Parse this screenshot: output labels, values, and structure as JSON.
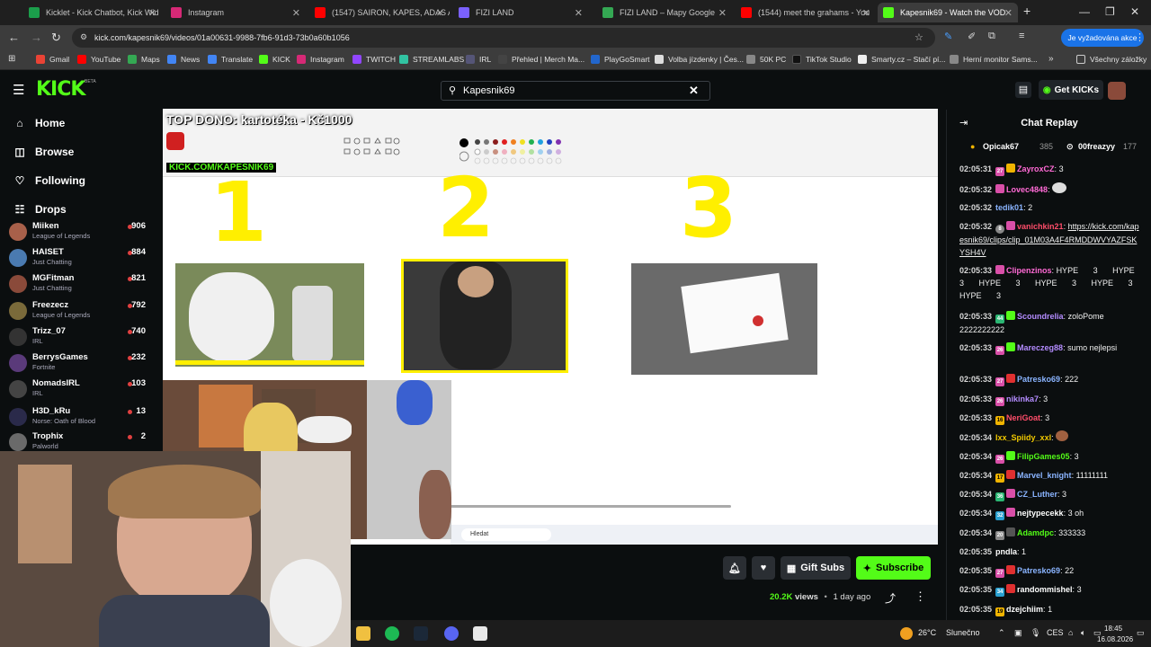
{
  "browser": {
    "tabs": [
      {
        "title": "Kicklet - Kick Chatbot, Kick Wid",
        "color": "#1b9e4b"
      },
      {
        "title": "Instagram",
        "color": "#d62976"
      },
      {
        "title": "(1547) SAIRON, KAPES, ADAS A",
        "color": "#ff0000"
      },
      {
        "title": "FIZI LAND",
        "color": "#7b61ff"
      },
      {
        "title": "FIZI LAND – Mapy Google",
        "color": "#34a853"
      },
      {
        "title": "(1544) meet the grahams - You",
        "color": "#ff0000"
      },
      {
        "title": "Kapesnik69 - Watch the VOD",
        "color": "#53fc18"
      }
    ],
    "url": "kick.com/kapesnik69/videos/01a00631-9988-7fb6-91d3-73b0a60b1056",
    "relaunch_label": "Je vyžadována akce",
    "bookmarks": [
      {
        "label": "Gmail",
        "color": "#ea4335"
      },
      {
        "label": "YouTube",
        "color": "#ff0000"
      },
      {
        "label": "Maps",
        "color": "#34a853"
      },
      {
        "label": "News",
        "color": "#4285f4"
      },
      {
        "label": "Translate",
        "color": "#4285f4"
      },
      {
        "label": "KICK",
        "color": "#53fc18"
      },
      {
        "label": "Instagram",
        "color": "#d62976"
      },
      {
        "label": "TWITCH",
        "color": "#9146ff"
      },
      {
        "label": "STREAMLABS",
        "color": "#31c3a2"
      },
      {
        "label": "IRL",
        "color": "#555577"
      },
      {
        "label": "Přehled | Merch Ma...",
        "color": "#444"
      },
      {
        "label": "PlayGoSmart",
        "color": "#2266cc"
      },
      {
        "label": "Volba jízdenky | Čes...",
        "color": "#dddddd"
      },
      {
        "label": "50K PC",
        "color": "#888"
      },
      {
        "label": "TikTok Studio",
        "color": "#111"
      },
      {
        "label": "Smarty.cz – Stačí pí...",
        "color": "#eeeeee"
      },
      {
        "label": "Herní monitor Sams...",
        "color": "#888"
      }
    ],
    "all_bookmarks": "Všechny záložky"
  },
  "kick": {
    "logo": "KICK",
    "logo_beta": "BETA",
    "search_value": "Kapesnik69",
    "get_kicks": "Get KICKs",
    "nav": [
      "Home",
      "Browse",
      "Following",
      "Drops"
    ],
    "channels": [
      {
        "name": "Miiken",
        "game": "League of Legends",
        "viewers": "906",
        "color": "#a8604a"
      },
      {
        "name": "HAISET",
        "game": "Just Chatting",
        "viewers": "884",
        "color": "#4a7ab0"
      },
      {
        "name": "MGFitman",
        "game": "Just Chatting",
        "viewers": "821",
        "color": "#8a4a3a"
      },
      {
        "name": "Freezecz",
        "game": "League of Legends",
        "viewers": "792",
        "color": "#7a6a3a"
      },
      {
        "name": "Trizz_07",
        "game": "IRL",
        "viewers": "740",
        "color": "#333333"
      },
      {
        "name": "BerrysGames",
        "game": "Fortnite",
        "viewers": "232",
        "color": "#5a3a7a"
      },
      {
        "name": "NomadsIRL",
        "game": "IRL",
        "viewers": "103",
        "color": "#444444"
      },
      {
        "name": "H3D_kRu",
        "game": "Norse: Oath of Blood",
        "viewers": "13",
        "color": "#2a2a4a"
      },
      {
        "name": "Trophix",
        "game": "Palworld",
        "viewers": "2",
        "color": "#6a6a6a"
      }
    ],
    "video": {
      "top_dono": "TOP DONO: kartotéka - Kč1000",
      "kick_url": "KICK.COM/KAPESNIK69",
      "numbers": [
        "1",
        "2",
        "3"
      ],
      "taskbar_search": "Hledat"
    },
    "actions": {
      "gift_subs": "Gift Subs",
      "subscribe": "Subscribe"
    },
    "meta": {
      "views": "20.2K",
      "views_label": "views",
      "separator": "•",
      "age": "1 day ago"
    }
  },
  "chat": {
    "title": "Chat Replay",
    "pinned": [
      {
        "name": "Opicak67",
        "count": "385"
      },
      {
        "name": "00freazyy",
        "count": "177"
      }
    ],
    "messages": [
      {
        "ts": "02:05:31",
        "badge": "27",
        "badge_color": "#d94fa8",
        "user": "ZayroxCZ",
        "color": "#ff6ad5",
        "text": "3"
      },
      {
        "ts": "02:05:32",
        "badge": "",
        "badge_color": "#d94fa8",
        "user": "Lovec4848",
        "color": "#ff6ad5",
        "text": ""
      },
      {
        "ts": "02:05:32",
        "badge": "",
        "badge_color": "",
        "user": "tedik01",
        "color": "#8ab4ff",
        "text": "2"
      },
      {
        "ts": "02:05:32",
        "badge": "8",
        "badge_color": "#888",
        "user": "vanichkin21",
        "color": "#ff4d6a",
        "text": "https://kick.com/kapesnik69/clips/clip_01M03A4F4RMDDWVYAZFSKYSH4V"
      },
      {
        "ts": "02:05:33",
        "badge": "",
        "badge_color": "#d94fa8",
        "user": "Clipenzinos",
        "color": "#ff6ad5",
        "text": "HYPE 3 HYPE 3 HYPE 3 HYPE 3 HYPE 3 HYPE 3"
      },
      {
        "ts": "02:05:33",
        "badge": "44",
        "badge_color": "#2bb673",
        "user": "Scoundrelia",
        "color": "#b48cff",
        "text": "zoloPome 2222222222"
      },
      {
        "ts": "02:05:33",
        "badge": "26",
        "badge_color": "#d94fa8",
        "user": "Mareczeg88",
        "color": "#b48cff",
        "text": "sumo nejlepsi"
      },
      {
        "ts": "02:05:33",
        "badge": "27",
        "badge_color": "#d94fa8",
        "user": "Patresko69",
        "color": "#8ab4ff",
        "text": "222"
      },
      {
        "ts": "02:05:33",
        "badge": "26",
        "badge_color": "#d94fa8",
        "user": "nikinka7",
        "color": "#b48cff",
        "text": "3"
      },
      {
        "ts": "02:05:33",
        "badge": "16",
        "badge_color": "#f0b400",
        "user": "NeriGoat",
        "color": "#ff4d6a",
        "text": "3"
      },
      {
        "ts": "02:05:34",
        "badge": "",
        "badge_color": "",
        "user": "Ixx_Spiidy_xxl",
        "color": "#f0c800",
        "text": ""
      },
      {
        "ts": "02:05:34",
        "badge": "26",
        "badge_color": "#d94fa8",
        "user": "FilipGames05",
        "color": "#53fc18",
        "text": "3"
      },
      {
        "ts": "02:05:34",
        "badge": "17",
        "badge_color": "#f0b400",
        "user": "Marvel_knight",
        "color": "#8ab4ff",
        "text": "11111111"
      },
      {
        "ts": "02:05:34",
        "badge": "36",
        "badge_color": "#2bb673",
        "user": "CZ_Luther",
        "color": "#8ab4ff",
        "text": "3"
      },
      {
        "ts": "02:05:34",
        "badge": "32",
        "badge_color": "#2aa0d0",
        "user": "nejtypecekk",
        "color": "#fff",
        "text": "3 oh"
      },
      {
        "ts": "02:05:34",
        "badge": "20",
        "badge_color": "#888",
        "user": "Adamdpc",
        "color": "#53fc18",
        "text": "333333"
      },
      {
        "ts": "02:05:35",
        "badge": "",
        "badge_color": "",
        "user": "pndla",
        "color": "#fff",
        "text": "1"
      },
      {
        "ts": "02:05:35",
        "badge": "27",
        "badge_color": "#d94fa8",
        "user": "Patresko69",
        "color": "#8ab4ff",
        "text": "22"
      },
      {
        "ts": "02:05:35",
        "badge": "34",
        "badge_color": "#2aa0d0",
        "user": "randommishel",
        "color": "#fff",
        "text": "3"
      },
      {
        "ts": "02:05:35",
        "badge": "19",
        "badge_color": "#f0b400",
        "user": "dzejchiim",
        "color": "#fff",
        "text": "1"
      }
    ]
  },
  "taskbar": {
    "weather": "26°C",
    "weather_label": "Slunečno",
    "lang": "CES",
    "time": "18:45",
    "date": "16.08.2026"
  }
}
